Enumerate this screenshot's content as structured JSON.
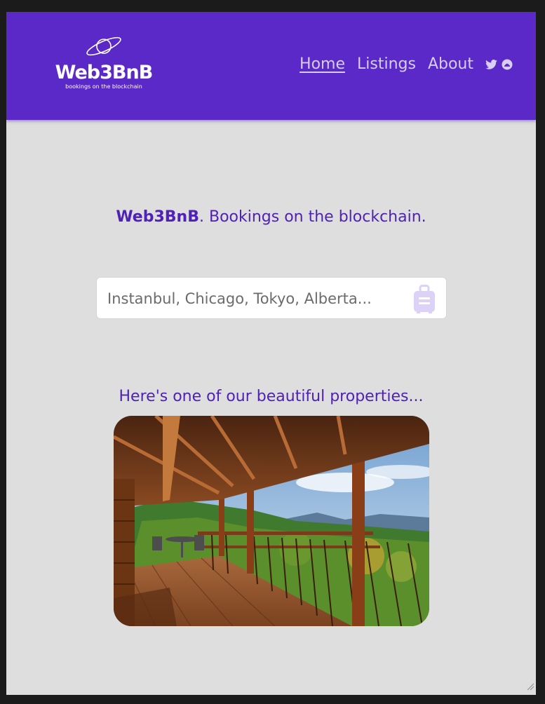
{
  "brand": {
    "name": "Web3BnB",
    "tagline": "bookings on the blockchain"
  },
  "nav": {
    "items": [
      {
        "label": "Home",
        "active": true
      },
      {
        "label": "Listings",
        "active": false
      },
      {
        "label": "About",
        "active": false
      }
    ],
    "icons": [
      "twitter-icon",
      "social-icon"
    ]
  },
  "hero": {
    "brand": "Web3BnB",
    "rest": ". Bookings on the blockchain."
  },
  "search": {
    "placeholder": "Instanbul, Chicago, Tokyo, Alberta...",
    "icon": "luggage-icon"
  },
  "featured": {
    "heading": "Here's one of our beautiful properties...",
    "image": "wooden-deck-mountain-view-photo"
  },
  "colors": {
    "header_bg": "#5b29c8",
    "accent_text": "#4f22b5",
    "page_bg": "#dedede",
    "nav_link": "#d6cdf2",
    "icon_tint": "#d9cff5"
  }
}
